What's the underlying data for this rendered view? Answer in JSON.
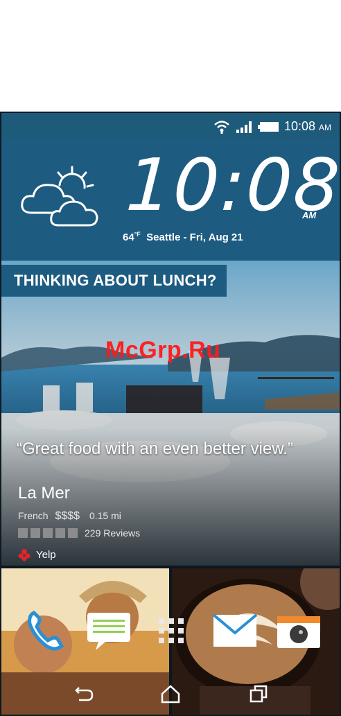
{
  "status_bar": {
    "time": "10:08",
    "ampm": "AM",
    "icons": [
      "wifi-icon",
      "signal-icon",
      "battery-icon"
    ]
  },
  "clock_widget": {
    "time": "10:08",
    "ampm": "AM",
    "temperature": "64",
    "unit": "°F",
    "location_date": "Seattle - Fri, Aug 21",
    "weather_icon": "partly-cloudy-icon"
  },
  "lunch_card": {
    "title": "THINKING ABOUT LUNCH?",
    "quote": "“Great food with an even better view.”",
    "restaurant_name": "La Mer",
    "cuisine": "French",
    "price": "$$$$",
    "distance": "0.15 mi",
    "stars_filled": 5,
    "reviews": "229 Reviews",
    "source": "Yelp"
  },
  "watermark": "McGrp.Ru",
  "dock": {
    "items": [
      "phone-icon",
      "messages-icon",
      "app-drawer-icon",
      "mail-icon",
      "camera-icon"
    ]
  },
  "nav_bar": {
    "items": [
      "back-icon",
      "home-icon",
      "recents-icon"
    ]
  },
  "colors": {
    "accent_blue": "#1d5b80",
    "status_bar": "#1e5a7a",
    "watermark_red": "#ff1a1a",
    "messages_green": "#8fd14f",
    "phone_blue": "#2b8fd6"
  }
}
